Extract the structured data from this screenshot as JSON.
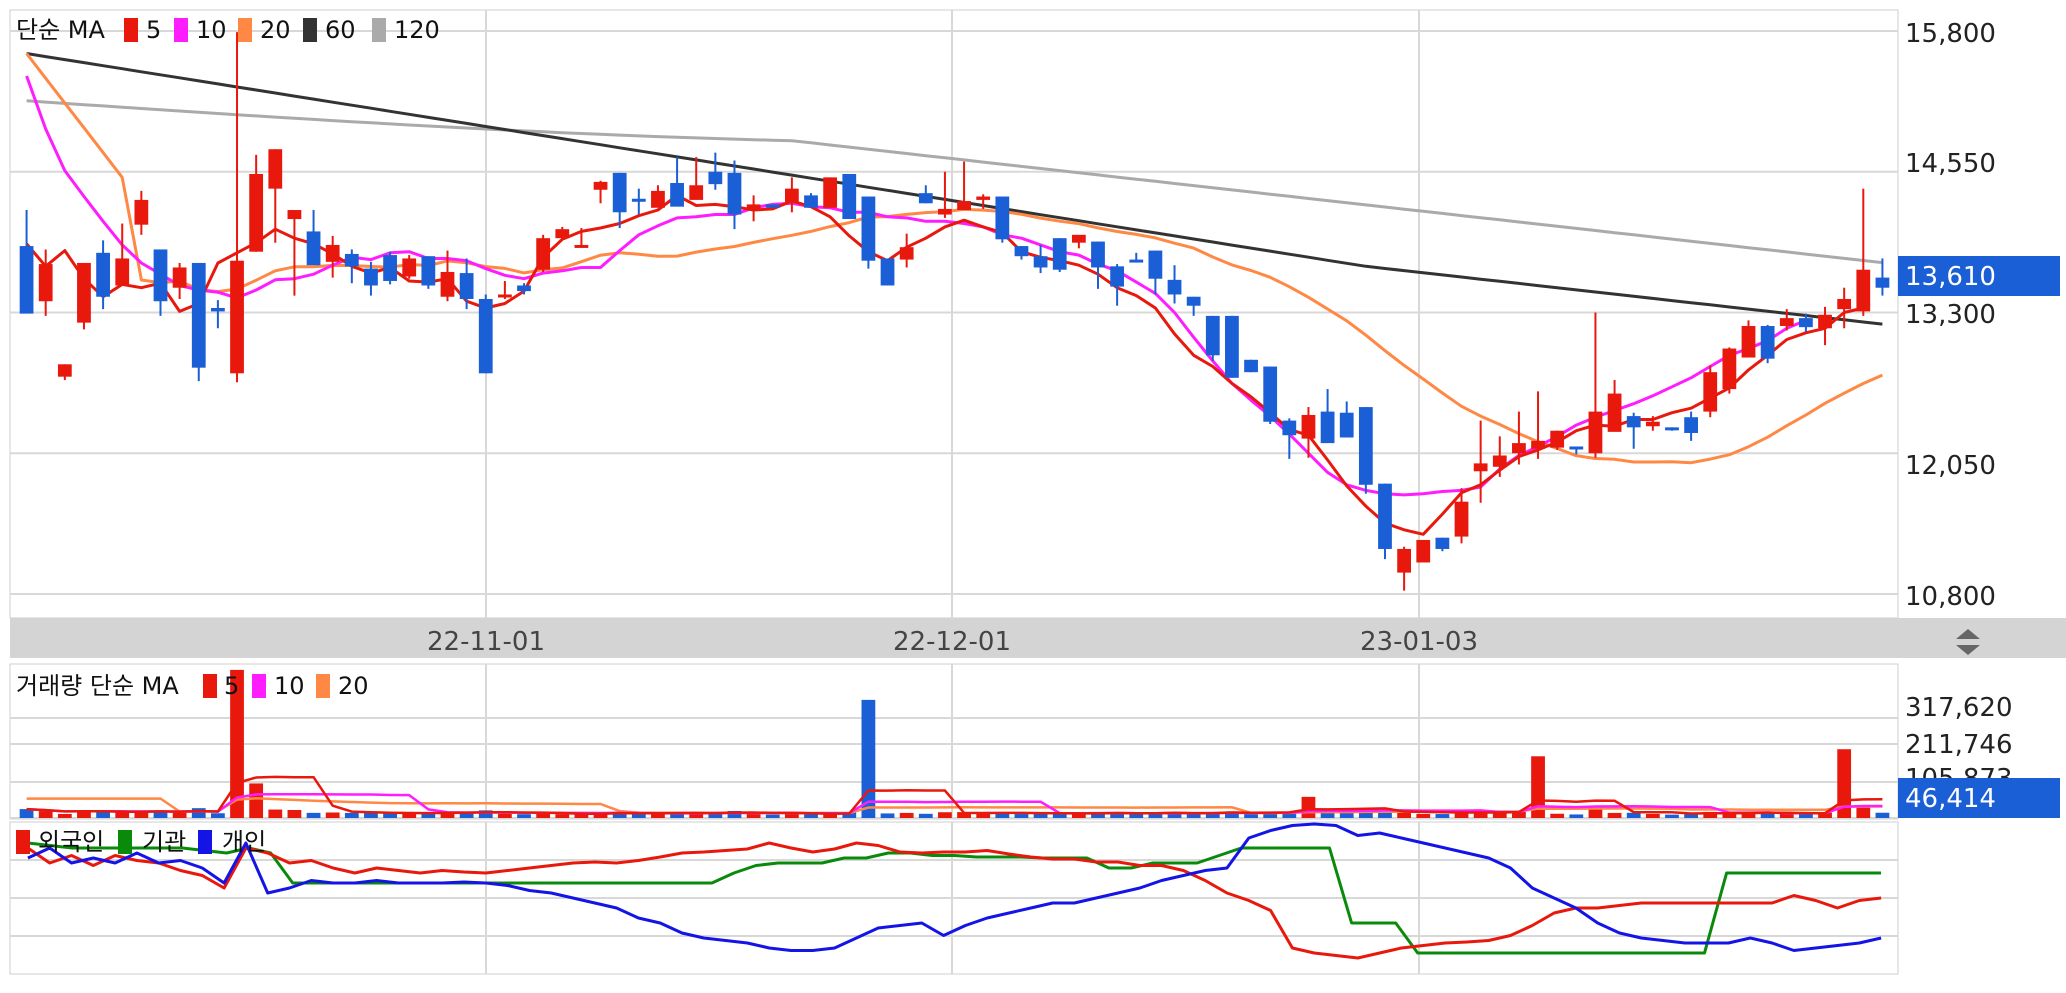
{
  "price_panel": {
    "legend": {
      "title": "단순 MA",
      "items": [
        {
          "label": "5",
          "color": "#e8180c"
        },
        {
          "label": "10",
          "color": "#ff1cff"
        },
        {
          "label": "20",
          "color": "#ff8844"
        },
        {
          "label": "60",
          "color": "#333333"
        },
        {
          "label": "120",
          "color": "#aaaaaa"
        }
      ]
    },
    "y_ticks": [
      "15,800",
      "14,550",
      "13,300",
      "12,050",
      "10,800"
    ],
    "current_price": "13,610",
    "current_color": "#1a5fd6"
  },
  "date_axis": {
    "labels": [
      "22-11-01",
      "22-12-01",
      "23-01-03"
    ],
    "scroll_icon": "up-down-arrows-icon"
  },
  "volume_panel": {
    "legend": {
      "title": "거래량 단순 MA",
      "items": [
        {
          "label": "5",
          "color": "#e8180c"
        },
        {
          "label": "10",
          "color": "#ff1cff"
        },
        {
          "label": "20",
          "color": "#ff8844"
        }
      ]
    },
    "y_ticks": [
      "317,620",
      "211,746",
      "105,873"
    ],
    "current_volume": "46,414"
  },
  "investor_panel": {
    "legend": [
      {
        "label": "외국인",
        "color": "#e8180c"
      },
      {
        "label": "기관",
        "color": "#0a8a0a"
      },
      {
        "label": "개인",
        "color": "#1414e6"
      }
    ]
  },
  "chart_data": {
    "type": "candlestick",
    "price_axis": {
      "min": 10800,
      "max": 15800
    },
    "volume_axis": {
      "min": 0,
      "max": 317620
    },
    "candles": [
      [
        13890,
        13290,
        13310,
        14210
      ],
      [
        13400,
        13730,
        13270,
        13860
      ],
      [
        12730,
        12840,
        12700,
        12840
      ],
      [
        13210,
        13740,
        13150,
        13740
      ],
      [
        13830,
        13440,
        13330,
        13940
      ],
      [
        13540,
        13780,
        13540,
        14090
      ],
      [
        14080,
        14300,
        13990,
        14380
      ],
      [
        13860,
        13400,
        13270,
        13860
      ],
      [
        13520,
        13700,
        13420,
        13740
      ],
      [
        13740,
        12810,
        12690,
        13740
      ],
      [
        13340,
        13310,
        13160,
        13410
      ],
      [
        12760,
        13760,
        12680,
        15790
      ],
      [
        13840,
        14530,
        13840,
        14700
      ],
      [
        14400,
        14750,
        13920,
        14750
      ],
      [
        14130,
        14210,
        13450,
        14210
      ],
      [
        14020,
        13720,
        13900,
        14210
      ],
      [
        13750,
        13900,
        13610,
        13980
      ],
      [
        13820,
        13710,
        13560,
        13860
      ],
      [
        13690,
        13540,
        13450,
        13750
      ],
      [
        13810,
        13580,
        13550,
        13840
      ],
      [
        13620,
        13780,
        13600,
        13810
      ],
      [
        13800,
        13540,
        13510,
        13800
      ],
      [
        13440,
        13660,
        13400,
        13850
      ],
      [
        13650,
        13420,
        13330,
        13780
      ],
      [
        13420,
        12760,
        12760,
        13460
      ],
      [
        13460,
        13460,
        13420,
        13580
      ],
      [
        13540,
        13490,
        13460,
        13560
      ],
      [
        13680,
        13960,
        13660,
        13990
      ],
      [
        13960,
        14040,
        13950,
        14060
      ],
      [
        13890,
        13900,
        13890,
        14050
      ],
      [
        14390,
        14460,
        14270,
        14470
      ],
      [
        14540,
        14190,
        14050,
        14540
      ],
      [
        14310,
        14290,
        14170,
        14400
      ],
      [
        14230,
        14380,
        14260,
        14430
      ],
      [
        14450,
        14240,
        14330,
        14680
      ],
      [
        14300,
        14430,
        14380,
        14680
      ],
      [
        14550,
        14440,
        14390,
        14720
      ],
      [
        14540,
        14170,
        14040,
        14650
      ],
      [
        14220,
        14260,
        14110,
        14340
      ],
      [
        14260,
        14230,
        14230,
        14260
      ],
      [
        14280,
        14400,
        14190,
        14500
      ],
      [
        14340,
        14230,
        14290,
        14360
      ],
      [
        14230,
        14500,
        14230,
        14500
      ],
      [
        14530,
        14130,
        14130,
        14530
      ],
      [
        14330,
        13760,
        13690,
        14330
      ],
      [
        13780,
        13540,
        13540,
        13760
      ],
      [
        13770,
        13880,
        13700,
        14000
      ],
      [
        14360,
        14270,
        14270,
        14430
      ],
      [
        14170,
        14220,
        14140,
        14550
      ],
      [
        14210,
        14290,
        14210,
        14640
      ],
      [
        14300,
        14330,
        14220,
        14350
      ],
      [
        14330,
        13950,
        13920,
        14330
      ],
      [
        13890,
        13800,
        13770,
        13890
      ],
      [
        13800,
        13700,
        13650,
        13900
      ],
      [
        13960,
        13680,
        13660,
        13960
      ],
      [
        13920,
        13990,
        13870,
        13930
      ],
      [
        13930,
        13700,
        13510,
        13930
      ],
      [
        13710,
        13530,
        13360,
        13730
      ],
      [
        13770,
        13750,
        13750,
        13830
      ],
      [
        13850,
        13600,
        13460,
        13850
      ],
      [
        13590,
        13460,
        13380,
        13720
      ],
      [
        13440,
        13360,
        13270,
        13440
      ],
      [
        13270,
        12920,
        12870,
        13270
      ],
      [
        13270,
        12720,
        12720,
        13270
      ],
      [
        12880,
        12770,
        12770,
        12880
      ],
      [
        12820,
        12330,
        12310,
        12820
      ],
      [
        12340,
        12210,
        12000,
        12360
      ],
      [
        12180,
        12390,
        12010,
        12460
      ],
      [
        12420,
        12140,
        12210,
        12620
      ],
      [
        12410,
        12190,
        12190,
        12510
      ],
      [
        12460,
        11770,
        11690,
        12460
      ],
      [
        11780,
        11200,
        11110,
        11780
      ],
      [
        10990,
        11200,
        10830,
        11220
      ],
      [
        11080,
        11280,
        11130,
        11270
      ],
      [
        11300,
        11200,
        11180,
        11300
      ],
      [
        11310,
        11620,
        11250,
        11740
      ],
      [
        11890,
        11960,
        11610,
        12340
      ],
      [
        11930,
        12030,
        11840,
        12200
      ],
      [
        12050,
        12140,
        11950,
        12420
      ],
      [
        12090,
        12160,
        12000,
        12600
      ],
      [
        12100,
        12250,
        12080,
        12250
      ],
      [
        12110,
        12090,
        12040,
        12100
      ],
      [
        12050,
        12420,
        12010,
        13300
      ],
      [
        12240,
        12580,
        12400,
        12700
      ],
      [
        12380,
        12280,
        12090,
        12410
      ],
      [
        12290,
        12330,
        12250,
        12380
      ],
      [
        12280,
        12260,
        12250,
        12280
      ],
      [
        12370,
        12230,
        12160,
        12420
      ],
      [
        12420,
        12770,
        12370,
        12830
      ],
      [
        12620,
        12980,
        12580,
        12990
      ],
      [
        12900,
        13180,
        13000,
        13230
      ],
      [
        13180,
        12890,
        12850,
        13190
      ],
      [
        13180,
        13250,
        13140,
        13330
      ],
      [
        13250,
        13170,
        13130,
        13290
      ],
      [
        13160,
        13280,
        13010,
        13350
      ],
      [
        13330,
        13420,
        13160,
        13520
      ],
      [
        13310,
        13680,
        13270,
        14400
      ],
      [
        13610,
        13520,
        13450,
        13780
      ]
    ],
    "ma": {
      "5": [
        13910,
        13710,
        13850,
        13600,
        13440,
        13550,
        13520,
        13560,
        13310,
        13380,
        13740,
        13830,
        13920,
        14040,
        13960,
        13910,
        13820,
        13710,
        13650,
        13700,
        13580,
        13570,
        13600,
        13400,
        13340,
        13380,
        13490,
        13790,
        13950,
        14020,
        14050,
        14090,
        14160,
        14210,
        14340,
        14250,
        14260,
        14240,
        14210,
        14220,
        14290,
        14240,
        14150,
        13980,
        13840,
        13760,
        13880,
        13960,
        14060,
        14120,
        14060,
        14010,
        13840,
        13790,
        13760,
        13720,
        13640,
        13520,
        13450,
        13340,
        13110,
        12920,
        12820,
        12670,
        12550,
        12410,
        12260,
        12210,
        11990,
        11760,
        11580,
        11430,
        11370,
        11330,
        11510,
        11700,
        11770,
        11900,
        12020,
        12080,
        12150,
        12250,
        12300,
        12290,
        12350,
        12350,
        12410,
        12450,
        12540,
        12630,
        12790,
        12920,
        13060,
        13120,
        13160,
        13300,
        13340
      ],
      "10": [
        15400,
        14930,
        14560,
        14330,
        14110,
        13900,
        13740,
        13640,
        13540,
        13500,
        13480,
        13430,
        13500,
        13590,
        13600,
        13640,
        13720,
        13790,
        13770,
        13830,
        13840,
        13780,
        13780,
        13760,
        13690,
        13630,
        13600,
        13650,
        13670,
        13700,
        13700,
        13850,
        13990,
        14070,
        14140,
        14150,
        14170,
        14170,
        14230,
        14260,
        14270,
        14240,
        14230,
        14190,
        14190,
        14150,
        14140,
        14110,
        14110,
        14090,
        14060,
        13990,
        13960,
        13900,
        13840,
        13810,
        13730,
        13670,
        13570,
        13470,
        13300,
        13080,
        12870,
        12670,
        12520,
        12380,
        12220,
        12050,
        11880,
        11770,
        11720,
        11690,
        11680,
        11690,
        11710,
        11720,
        11750,
        11910,
        12030,
        12110,
        12200,
        12300,
        12370,
        12430,
        12490,
        12560,
        12640,
        12720,
        12820,
        12920,
        12980,
        13050,
        13160,
        13230
      ]
    },
    "investor_lines": {
      "foreign": [
        1,
        0.7,
        0.85,
        0.65,
        0.85,
        0.75,
        0.7,
        0.55,
        0.45,
        0.2,
        1,
        0.9,
        0.7,
        0.75,
        0.6,
        0.5,
        0.6,
        0.55,
        0.5,
        0.55,
        0.52,
        0.5,
        0.55,
        0.6,
        0.65,
        0.7,
        0.72,
        0.7,
        0.75,
        0.82,
        0.9,
        0.92,
        0.95,
        0.98,
        1.1,
        1.0,
        0.92,
        0.98,
        1.1,
        1.05,
        0.92,
        0.9,
        0.92,
        0.92,
        0.95,
        0.88,
        0.82,
        0.78,
        0.78,
        0.72,
        0.72,
        0.65,
        0.65,
        0.55,
        0.35,
        0.1,
        -0.05,
        -0.25,
        -1.0,
        -1.1,
        -1.15,
        -1.2,
        -1.1,
        -1.0,
        -0.95,
        -0.9,
        -0.88,
        -0.85,
        -0.75,
        -0.55,
        -0.3,
        -0.2,
        -0.2,
        -0.15,
        -0.1,
        -0.1,
        -0.1,
        -0.1,
        -0.1,
        -0.1,
        -0.1,
        0.05,
        -0.05,
        -0.2,
        -0.05,
        0.0
      ],
      "institution": [
        1.1,
        1.05,
        1.0,
        1.0,
        1.0,
        1.0,
        1.0,
        1.0,
        0.95,
        0.9,
        1.0,
        0.9,
        0.3,
        0.3,
        0.3,
        0.3,
        0.3,
        0.3,
        0.3,
        0.3,
        0.3,
        0.3,
        0.3,
        0.3,
        0.3,
        0.3,
        0.3,
        0.3,
        0.3,
        0.3,
        0.3,
        0.3,
        0.5,
        0.65,
        0.7,
        0.7,
        0.7,
        0.8,
        0.8,
        0.9,
        0.9,
        0.85,
        0.85,
        0.82,
        0.82,
        0.82,
        0.8,
        0.8,
        0.8,
        0.6,
        0.6,
        0.7,
        0.7,
        0.7,
        0.85,
        1.0,
        1.0,
        1.0,
        1.0,
        1.0,
        -0.5,
        -0.5,
        -0.5,
        -1.1,
        -1.1,
        -1.1,
        -1.1,
        -1.1,
        -1.1,
        -1.1,
        -1.1,
        -1.1,
        -1.1,
        -1.1,
        -1.1,
        -1.1,
        -1.1,
        0.5,
        0.5,
        0.5,
        0.5,
        0.5,
        0.5,
        0.5,
        0.5
      ],
      "individual": [
        0.8,
        1.0,
        0.7,
        0.8,
        0.7,
        0.9,
        0.7,
        0.75,
        0.6,
        0.3,
        1.1,
        0.1,
        0.2,
        0.35,
        0.3,
        0.3,
        0.35,
        0.3,
        0.3,
        0.3,
        0.32,
        0.3,
        0.25,
        0.15,
        0.1,
        0.0,
        -0.1,
        -0.2,
        -0.4,
        -0.5,
        -0.7,
        -0.8,
        -0.85,
        -0.9,
        -1.0,
        -1.05,
        -1.05,
        -1.0,
        -0.8,
        -0.6,
        -0.55,
        -0.5,
        -0.75,
        -0.55,
        -0.4,
        -0.3,
        -0.2,
        -0.1,
        -0.1,
        0.0,
        0.1,
        0.2,
        0.35,
        0.45,
        0.55,
        0.6,
        1.2,
        1.35,
        1.45,
        1.5,
        1.45,
        1.25,
        1.3,
        1.2,
        1.1,
        1.0,
        0.9,
        0.8,
        0.6,
        0.2,
        0.0,
        -0.2,
        -0.5,
        -0.7,
        -0.8,
        -0.85,
        -0.9,
        -0.9,
        -0.9,
        -0.8,
        -0.9,
        -1.05,
        -1.0,
        -0.95,
        -0.9,
        -0.8
      ]
    }
  }
}
